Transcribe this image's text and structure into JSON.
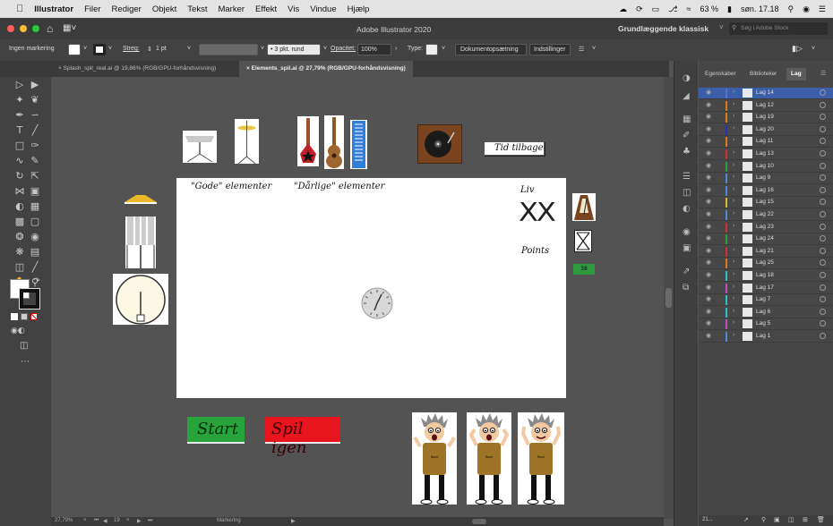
{
  "menubar": {
    "apple": "",
    "items": [
      "Illustrator",
      "Filer",
      "Rediger",
      "Objekt",
      "Tekst",
      "Marker",
      "Effekt",
      "Vis",
      "Vindue",
      "Hjælp"
    ],
    "battery": "63 %",
    "clock": "søn. 17.18"
  },
  "titlebar": {
    "title": "Adobe Illustrator 2020",
    "workspace": "Grundlæggende klassisk",
    "search_placeholder": "Søg i Adobe Stock"
  },
  "control": {
    "selection": "Ingen markering",
    "stroke_label": "Streg:",
    "stroke_value": "1 pt",
    "brush": "3 pkt. rund",
    "opacity_label": "Opacitet:",
    "opacity_value": "100%",
    "type_label": "Type:",
    "doc_setup": "Dokumentopsætning",
    "prefs": "Indstillinger"
  },
  "tabs": [
    {
      "label": "Splash_spil_real.ai @ 19,86% (RGB/GPU-forhåndsvisning)"
    },
    {
      "label": "Elements_spil.ai @ 27,79% (RGB/GPU-forhåndsvisning)"
    }
  ],
  "canvas": {
    "tid_tilbage": "Tid tilbage",
    "gode": "\"Gode\" elementer",
    "daarlige": "\"Dårlige\" elementer",
    "liv": "Liv",
    "lives_mark": "XX",
    "points": "Points",
    "score": "38",
    "start": "Start",
    "spil_igen": "Spil igen",
    "shirt_text": "Rock"
  },
  "panel": {
    "tabs": [
      "Egenskaber",
      "Biblioteker",
      "Lag"
    ],
    "layers": [
      {
        "name": "Lag 14",
        "color": "#5a6bd8"
      },
      {
        "name": "Lag 12",
        "color": "#e07a18"
      },
      {
        "name": "Lag 19",
        "color": "#e07a18"
      },
      {
        "name": "Lag 20",
        "color": "#2030c0"
      },
      {
        "name": "Lag 11",
        "color": "#e07a18"
      },
      {
        "name": "Lag 13",
        "color": "#d03030"
      },
      {
        "name": "Lag 10",
        "color": "#30a030"
      },
      {
        "name": "Lag 9",
        "color": "#4a8ad8"
      },
      {
        "name": "Lag 16",
        "color": "#4a8ad8"
      },
      {
        "name": "Lag 15",
        "color": "#d0c030"
      },
      {
        "name": "Lag 22",
        "color": "#4a8ad8"
      },
      {
        "name": "Lag 23",
        "color": "#d03030"
      },
      {
        "name": "Lag 24",
        "color": "#30a030"
      },
      {
        "name": "Lag 21",
        "color": "#d03030"
      },
      {
        "name": "Lag 25",
        "color": "#e07a18"
      },
      {
        "name": "Lag 18",
        "color": "#30c0c0"
      },
      {
        "name": "Lag 17",
        "color": "#c050c0"
      },
      {
        "name": "Lag 7",
        "color": "#30c0c0"
      },
      {
        "name": "Lag 6",
        "color": "#30c0c0"
      },
      {
        "name": "Lag 5",
        "color": "#c050c0"
      },
      {
        "name": "Lag 1",
        "color": "#4a8ad8"
      }
    ],
    "footer": "21..."
  },
  "status": {
    "zoom": "27,79%",
    "page": "19",
    "mode": "Markering"
  }
}
